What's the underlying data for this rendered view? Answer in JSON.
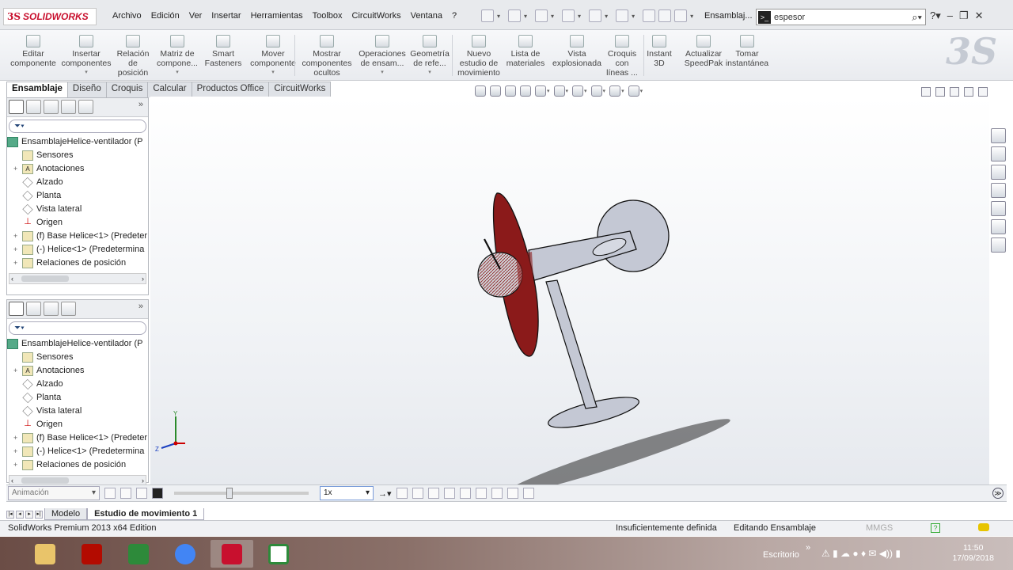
{
  "app": {
    "logo_ds": "3S",
    "logo_name": "SOLIDWORKS",
    "doc_title": "Ensamblaj..."
  },
  "menu": [
    "Archivo",
    "Edición",
    "Ver",
    "Insertar",
    "Herramientas",
    "Toolbox",
    "CircuitWorks",
    "Ventana",
    "?"
  ],
  "search": {
    "value": "espesor",
    "prompt_icon": "command-prompt-icon"
  },
  "toolbar": [
    {
      "l1": "Editar",
      "l2": "componente",
      "l3": "",
      "dd": ""
    },
    {
      "l1": "Insertar",
      "l2": "componentes",
      "l3": "",
      "dd": "▾"
    },
    {
      "l1": "Relación",
      "l2": "de",
      "l3": "posición",
      "dd": ""
    },
    {
      "l1": "Matriz de",
      "l2": "compone...",
      "l3": "",
      "dd": "▾"
    },
    {
      "l1": "Smart",
      "l2": "Fasteners",
      "l3": "",
      "dd": ""
    },
    {
      "l1": "Mover",
      "l2": "componente",
      "l3": "",
      "dd": "▾"
    },
    {
      "l1": "Mostrar",
      "l2": "componentes",
      "l3": "ocultos",
      "dd": ""
    },
    {
      "l1": "Operaciones",
      "l2": "de ensam...",
      "l3": "",
      "dd": "▾"
    },
    {
      "l1": "Geometría",
      "l2": "de refe...",
      "l3": "",
      "dd": "▾"
    },
    {
      "l1": "Nuevo",
      "l2": "estudio de",
      "l3": "movimiento",
      "dd": ""
    },
    {
      "l1": "Lista de",
      "l2": "materiales",
      "l3": "",
      "dd": ""
    },
    {
      "l1": "Vista",
      "l2": "explosionada",
      "l3": "",
      "dd": ""
    },
    {
      "l1": "Croquis",
      "l2": "con",
      "l3": "líneas ...",
      "dd": ""
    },
    {
      "l1": "Instant",
      "l2": "3D",
      "l3": "",
      "dd": ""
    },
    {
      "l1": "Actualizar",
      "l2": "SpeedPak",
      "l3": "",
      "dd": ""
    },
    {
      "l1": "Tomar",
      "l2": "instantánea",
      "l3": "",
      "dd": ""
    }
  ],
  "cm_tabs": [
    "Ensamblaje",
    "Diseño",
    "Croquis",
    "Calcular",
    "Productos Office",
    "CircuitWorks"
  ],
  "tree": {
    "root": "EnsamblajeHelice-ventilador  (P",
    "items": [
      {
        "label": "Sensores",
        "icon": "sensor-icon",
        "exp": ""
      },
      {
        "label": "Anotaciones",
        "icon": "annotation-icon",
        "exp": "+"
      },
      {
        "label": "Alzado",
        "icon": "plane-icon",
        "exp": ""
      },
      {
        "label": "Planta",
        "icon": "plane-icon",
        "exp": ""
      },
      {
        "label": "Vista lateral",
        "icon": "plane-icon",
        "exp": ""
      },
      {
        "label": "Origen",
        "icon": "origin-icon",
        "exp": ""
      },
      {
        "label": "(f) Base Helice<1> (Predeter",
        "icon": "part-icon",
        "exp": "+"
      },
      {
        "label": "(-) Helice<1> (Predetermina",
        "icon": "part-icon",
        "exp": "+"
      },
      {
        "label": "Relaciones de posición",
        "icon": "mates-icon",
        "exp": "+"
      }
    ]
  },
  "animation": {
    "type": "Animación",
    "speed": "1x"
  },
  "bottom_tabs": [
    "Modelo",
    "Estudio de movimiento 1"
  ],
  "status": {
    "edition": "SolidWorks Premium 2013 x64 Edition",
    "state": "Insuficientemente definida",
    "mode": "Editando Ensamblaje",
    "units": "MMGS"
  },
  "taskbar": {
    "desktop": "Escritorio",
    "time": "11:50",
    "date": "17/09/2018"
  },
  "colors": {
    "brand": "#c8102e",
    "blade": "#8b1a1a",
    "metal": "#c4c8d4",
    "shadow": "#2a2a2a"
  }
}
